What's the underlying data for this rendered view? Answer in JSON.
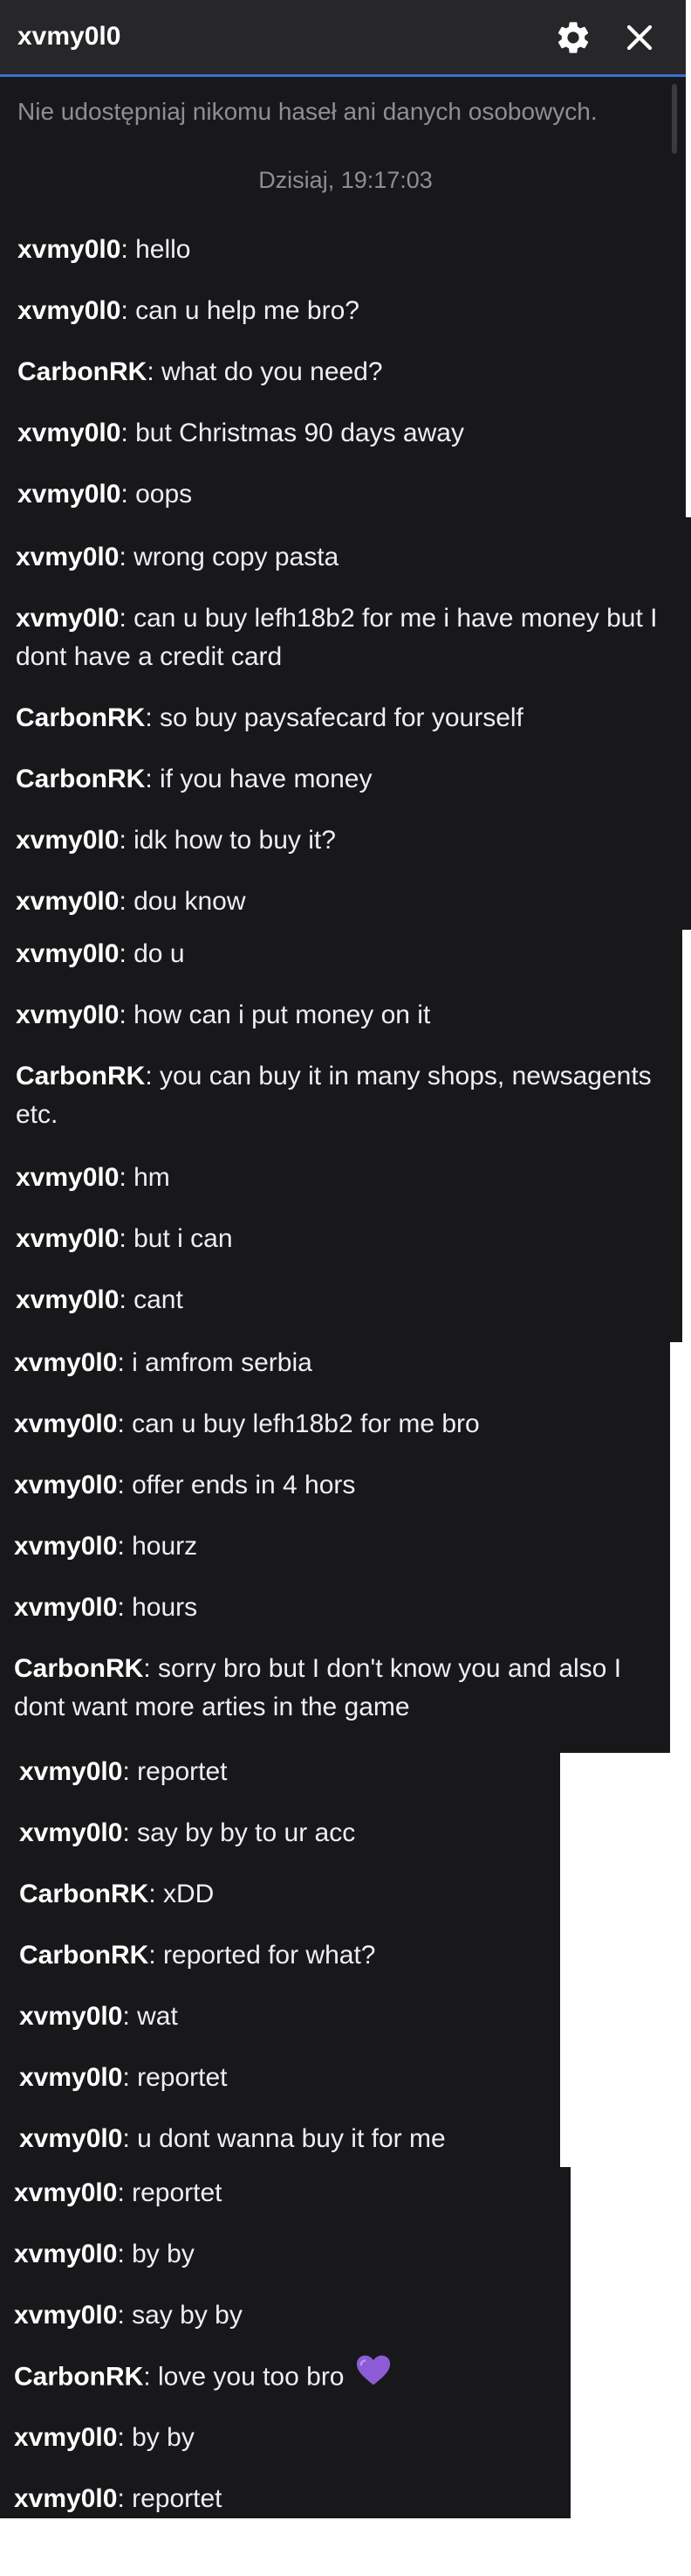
{
  "header": {
    "title": "xvmy0l0",
    "settings_icon": "gear-icon",
    "close_icon": "close-icon"
  },
  "notice": "Nie udostępniaj nikomu haseł ani danych osobowych.",
  "timestamp": "Dzisiaj, 19:17:03",
  "colors": {
    "background": "#18181b",
    "header": "#27272a",
    "accent": "#3b6ed1",
    "muted_text": "#8e8e96",
    "heart": "#8d5bd6"
  },
  "messages": [
    {
      "user": "xvmy0l0",
      "text": "hello"
    },
    {
      "user": "xvmy0l0",
      "text": "can u help me bro?"
    },
    {
      "user": "CarbonRK",
      "text": "what do you need?"
    },
    {
      "user": "xvmy0l0",
      "text": "but Christmas 90 days away"
    },
    {
      "user": "xvmy0l0",
      "text": "oops"
    },
    {
      "user": "xvmy0l0",
      "text": "wrong copy pasta"
    },
    {
      "user": "xvmy0l0",
      "text": "can u buy lefh18b2 for me i have money but I dont have a credit card"
    },
    {
      "user": "CarbonRK",
      "text": "so buy paysafecard for yourself"
    },
    {
      "user": "CarbonRK",
      "text": "if you have money"
    },
    {
      "user": "xvmy0l0",
      "text": "idk how to buy it?"
    },
    {
      "user": "xvmy0l0",
      "text": "dou know"
    },
    {
      "user": "xvmy0l0",
      "text": "do u"
    },
    {
      "user": "xvmy0l0",
      "text": "how can i put money on it"
    },
    {
      "user": "CarbonRK",
      "text": "you can buy it in many shops, newsagents etc."
    },
    {
      "user": "xvmy0l0",
      "text": "hm"
    },
    {
      "user": "xvmy0l0",
      "text": "but i can"
    },
    {
      "user": "xvmy0l0",
      "text": "cant"
    },
    {
      "user": "xvmy0l0",
      "text": "i amfrom serbia"
    },
    {
      "user": "xvmy0l0",
      "text": "can u buy lefh18b2 for me bro"
    },
    {
      "user": "xvmy0l0",
      "text": "offer ends in 4 hors"
    },
    {
      "user": "xvmy0l0",
      "text": "hourz"
    },
    {
      "user": "xvmy0l0",
      "text": "hours"
    },
    {
      "user": "CarbonRK",
      "text": "sorry bro but I don't know you and also I dont want more arties in the game"
    },
    {
      "user": "xvmy0l0",
      "text": "reportet"
    },
    {
      "user": "xvmy0l0",
      "text": "say by by to ur acc"
    },
    {
      "user": "CarbonRK",
      "text": "xDD"
    },
    {
      "user": "CarbonRK",
      "text": "reported for what?"
    },
    {
      "user": "xvmy0l0",
      "text": "wat"
    },
    {
      "user": "xvmy0l0",
      "text": "reportet"
    },
    {
      "user": "xvmy0l0",
      "text": "u dont wanna buy it for me"
    },
    {
      "user": "xvmy0l0",
      "text": "reportet"
    },
    {
      "user": "xvmy0l0",
      "text": "by by"
    },
    {
      "user": "xvmy0l0",
      "text": "say by by"
    },
    {
      "user": "CarbonRK",
      "text": "love you too bro",
      "emoji": "purple-heart-icon"
    },
    {
      "user": "xvmy0l0",
      "text": "by by"
    },
    {
      "user": "xvmy0l0",
      "text": "reportet"
    }
  ]
}
